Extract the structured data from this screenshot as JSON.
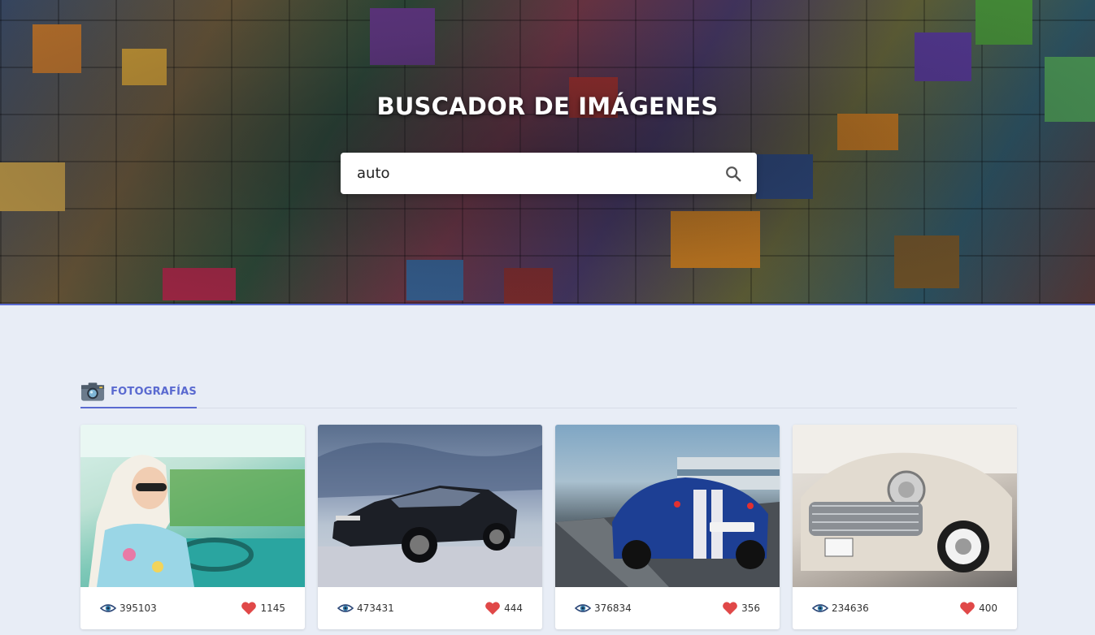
{
  "header": {
    "title": "BUSCADOR DE IMÁGENES",
    "search": {
      "value": "auto",
      "placeholder": ""
    }
  },
  "tabs": [
    {
      "label": "FOTOGRAFÍAS",
      "icon": "camera-icon",
      "active": true
    }
  ],
  "photos": [
    {
      "views": "395103",
      "likes": "1145",
      "subject": "woman-in-vintage-car"
    },
    {
      "views": "473431",
      "likes": "444",
      "subject": "black-mustang"
    },
    {
      "views": "376834",
      "likes": "356",
      "subject": "blue-ferrari-racetrack"
    },
    {
      "views": "234636",
      "likes": "400",
      "subject": "classic-cadillac"
    }
  ],
  "colors": {
    "accent": "#5a6ad0",
    "background": "#e8edf6",
    "heart": "#e04848",
    "eye": "#2f4a7a"
  }
}
